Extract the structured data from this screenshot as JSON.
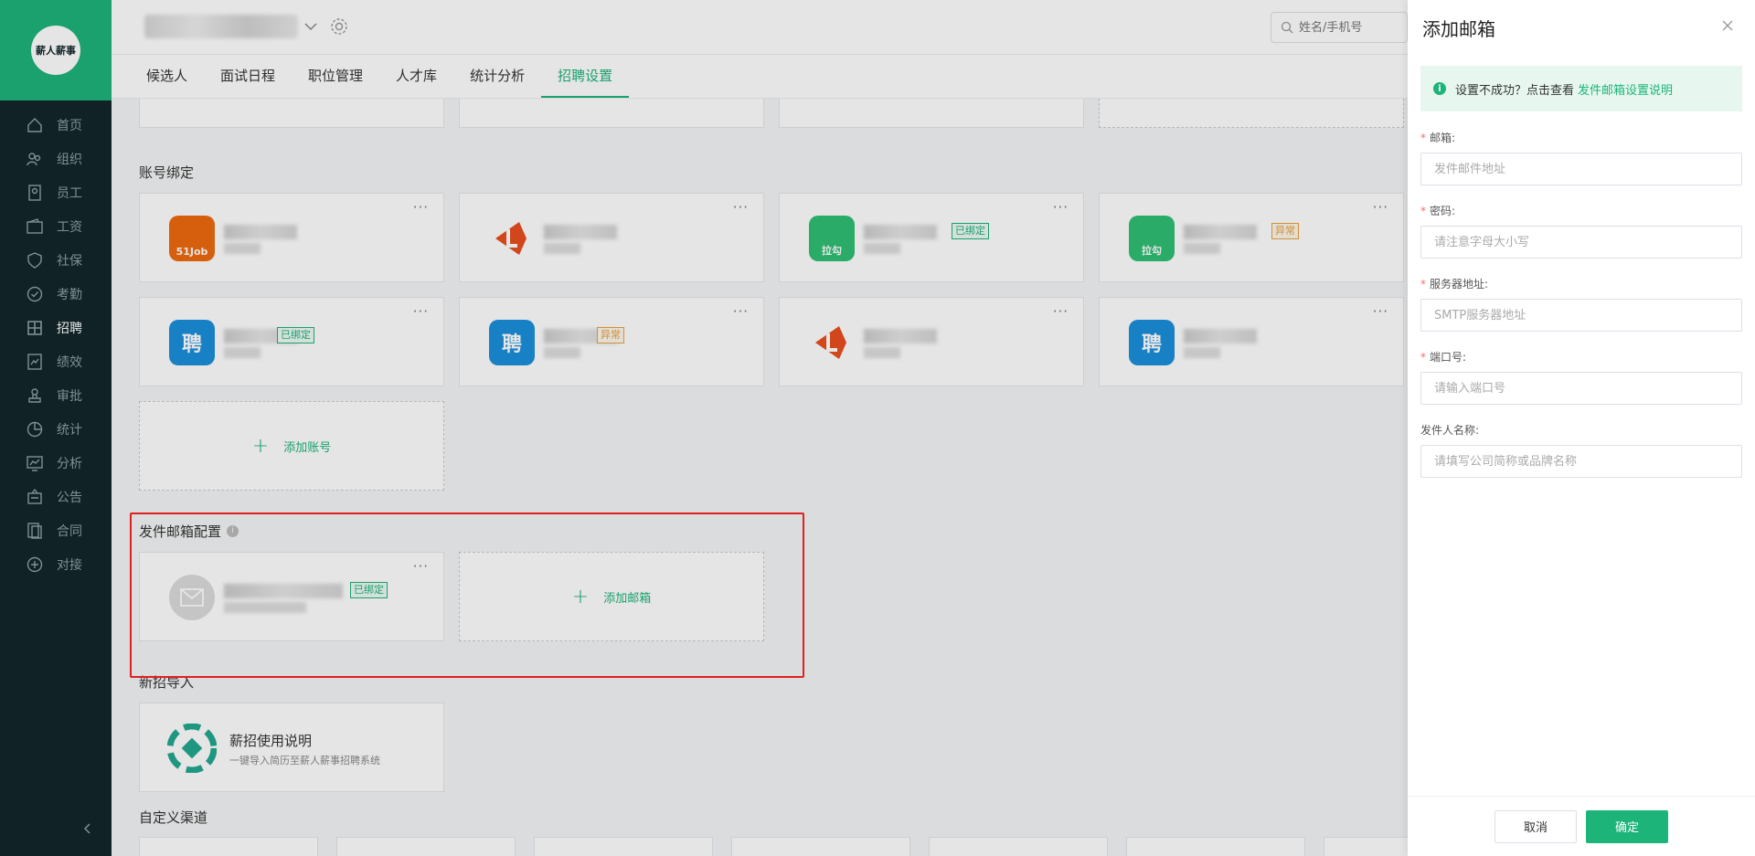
{
  "logo_text": "薪人薪事",
  "sidebar": {
    "items": [
      {
        "label": "首页",
        "icon": "home-icon"
      },
      {
        "label": "组织",
        "icon": "org-icon"
      },
      {
        "label": "员工",
        "icon": "employee-icon"
      },
      {
        "label": "工资",
        "icon": "wallet-icon"
      },
      {
        "label": "社保",
        "icon": "shield-icon"
      },
      {
        "label": "考勤",
        "icon": "check-circle-icon"
      },
      {
        "label": "招聘",
        "icon": "recruit-icon",
        "active": true
      },
      {
        "label": "绩效",
        "icon": "performance-icon"
      },
      {
        "label": "审批",
        "icon": "stamp-icon"
      },
      {
        "label": "统计",
        "icon": "pie-chart-icon"
      },
      {
        "label": "分析",
        "icon": "analysis-icon"
      },
      {
        "label": "公告",
        "icon": "notice-icon"
      },
      {
        "label": "合同",
        "icon": "contract-icon"
      },
      {
        "label": "对接",
        "icon": "link-icon"
      }
    ]
  },
  "header": {
    "search_placeholder": "姓名/手机号"
  },
  "tabs": [
    "候选人",
    "面试日程",
    "职位管理",
    "人才库",
    "统计分析",
    "招聘设置"
  ],
  "active_tab": "招聘设置",
  "sections": {
    "account_binding": "账号绑定",
    "add_account": "添加账号",
    "mail_config": "发件邮箱配置",
    "add_mail": "添加邮箱",
    "new_import": "新招导入",
    "import_title": "薪招使用说明",
    "import_desc": "一键导入简历至薪人薪事招聘系统",
    "custom_channel": "自定义渠道"
  },
  "accounts": [
    {
      "logo": "51job",
      "tag": ""
    },
    {
      "logo": "liepin",
      "tag": ""
    },
    {
      "logo": "lagou",
      "tag": "已绑定"
    },
    {
      "logo": "lagou",
      "tag": "异常"
    },
    {
      "logo": "zhaopin",
      "tag": "已绑定"
    },
    {
      "logo": "zhaopin",
      "tag": "异常"
    },
    {
      "logo": "liepin",
      "tag": ""
    },
    {
      "logo": "zhaopin",
      "tag": ""
    }
  ],
  "mail_card_tag": "已绑定",
  "logo_labels": {
    "51job": "51Job",
    "lagou": "拉勾",
    "zhaopin": "聘"
  },
  "card_menu": "···",
  "drawer": {
    "title": "添加邮箱",
    "alert_text": "设置不成功？点击查看",
    "alert_link": "发件邮箱设置说明",
    "fields": [
      {
        "label": "邮箱:",
        "placeholder": "发件邮件地址",
        "required": true
      },
      {
        "label": "密码:",
        "placeholder": "请注意字母大小写",
        "required": true
      },
      {
        "label": "服务器地址:",
        "placeholder": "SMTP服务器地址",
        "required": true
      },
      {
        "label": "端口号:",
        "placeholder": "请输入端口号",
        "required": true
      },
      {
        "label": "发件人名称:",
        "placeholder": "请填写公司简称或品牌名称",
        "required": false
      }
    ],
    "cancel": "取消",
    "confirm": "确定"
  },
  "colors": {
    "brand": "#1db47a",
    "sidebar_bg": "#12262a",
    "warn": "#e9a23b",
    "highlight": "#e02020"
  }
}
